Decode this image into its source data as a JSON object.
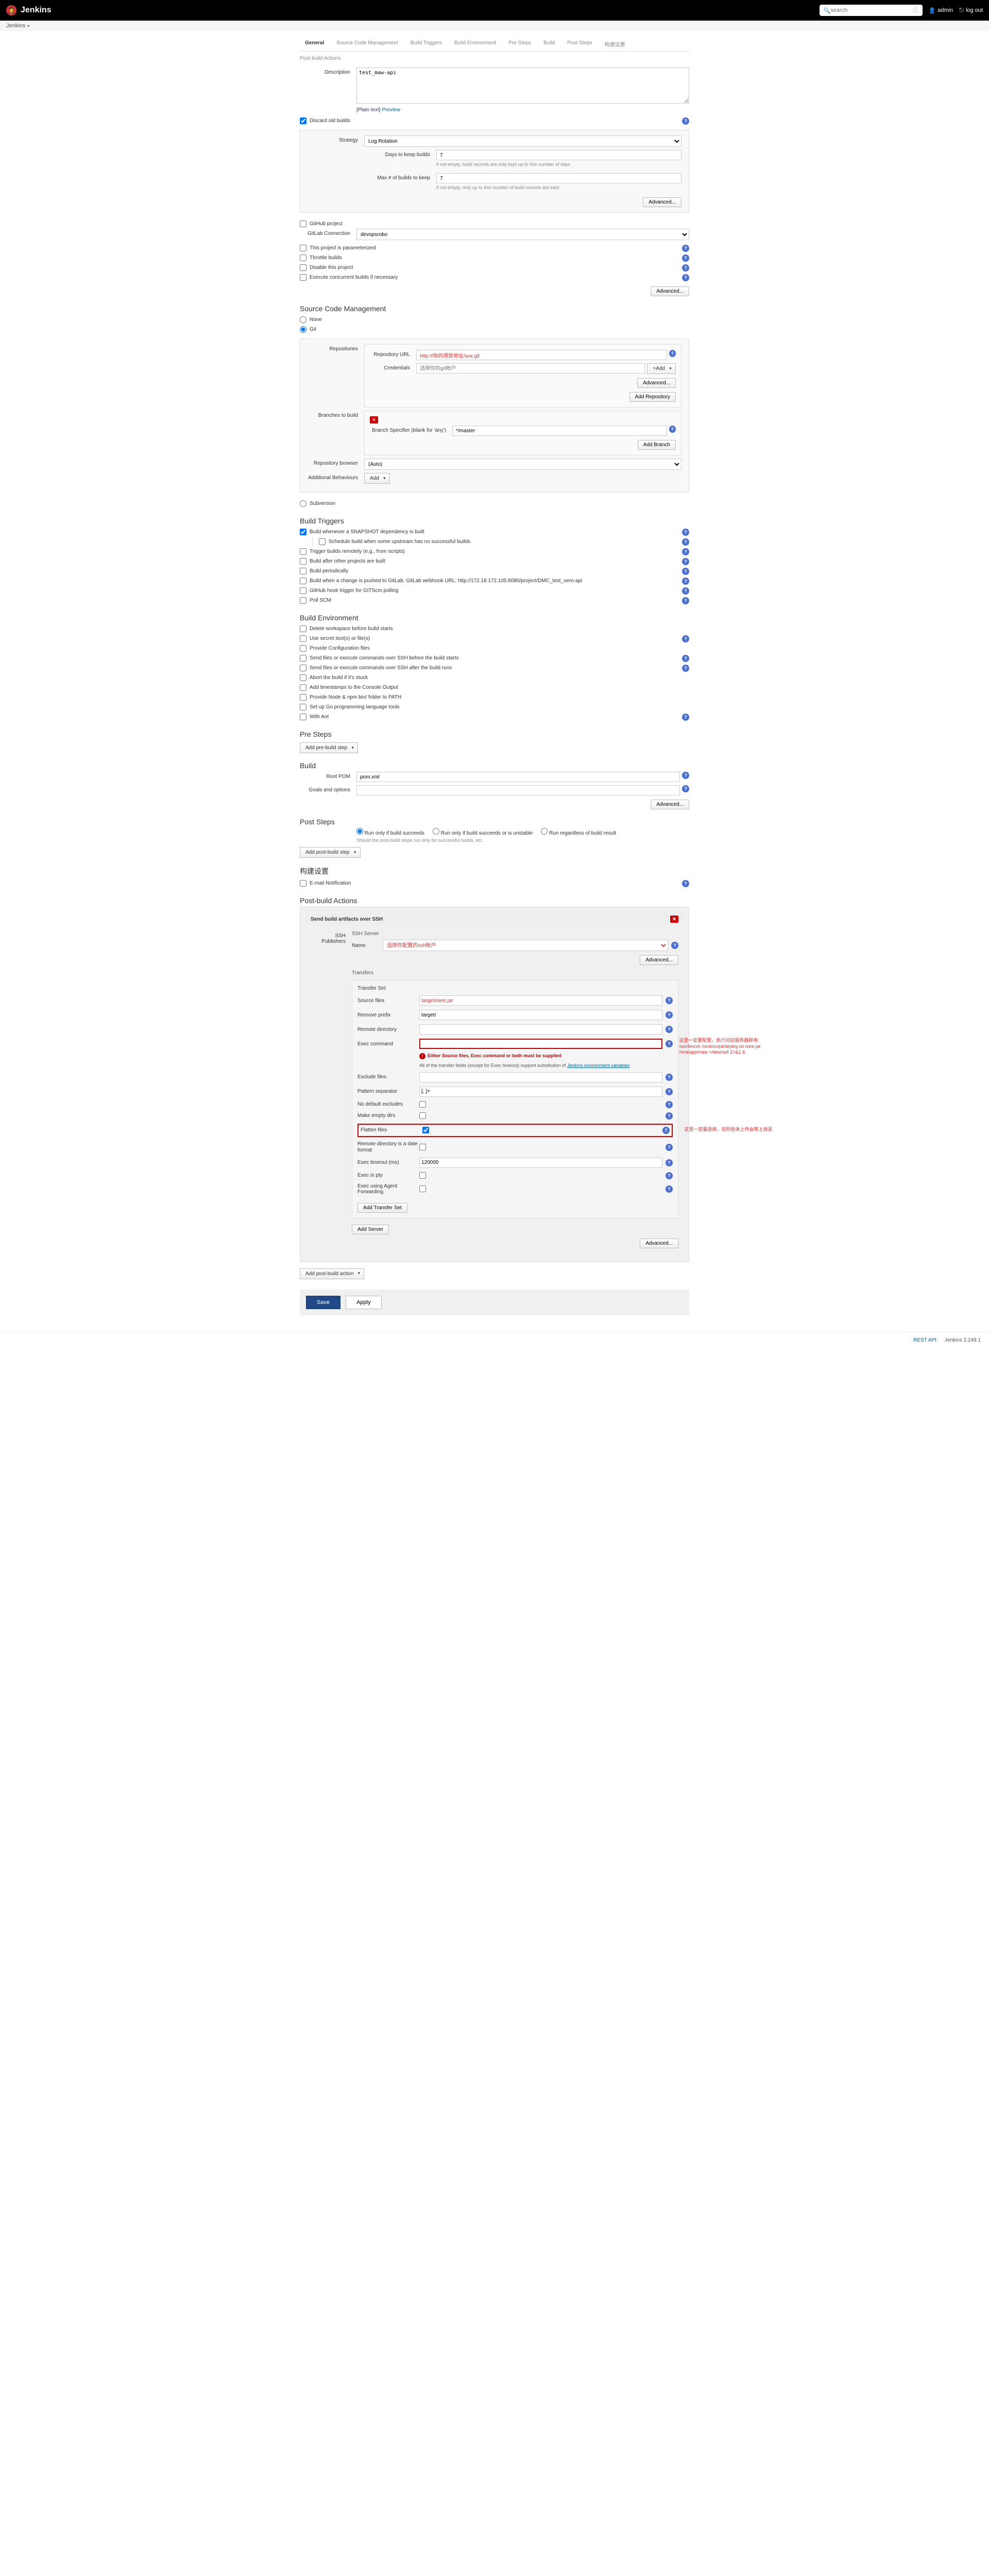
{
  "header": {
    "logo": "Jenkins",
    "search_placeholder": "search",
    "user": "admin",
    "logout": "log out"
  },
  "breadcrumb": {
    "item": "Jenkins"
  },
  "tabs": {
    "general": "General",
    "scm": "Source Code Management",
    "triggers": "Build Triggers",
    "env": "Build Environment",
    "presteps": "Pre Steps",
    "build": "Build",
    "poststeps": "Post Steps",
    "construct": "构建设置",
    "postbuild": "Post-build Actions"
  },
  "general": {
    "description_label": "Description",
    "description_value": "test_maw-api",
    "plain_text": "[Plain text]",
    "preview": "Preview",
    "discard_label": "Discard old builds",
    "strategy_label": "Strategy",
    "strategy_value": "Log Rotation",
    "days_keep_label": "Days to keep builds",
    "days_keep_value": "7",
    "days_hint": "if not empty, build records are only kept up to this number of days",
    "max_builds_label": "Max # of builds to keep",
    "max_builds_value": "7",
    "max_hint": "if not empty, only up to this number of build records are kept",
    "advanced": "Advanced...",
    "github_project": "GitHub project",
    "gitlab_conn_label": "GitLab Connection",
    "gitlab_conn_value": "devopsrobo",
    "param_label": "This project is parameterized",
    "throttle_label": "Throttle builds",
    "disable_label": "Disable this project",
    "concurrent_label": "Execute concurrent builds if necessary"
  },
  "scm": {
    "title": "Source Code Management",
    "none": "None",
    "git": "Git",
    "repositories_label": "Repositories",
    "repo_url_label": "Repository URL",
    "repo_url_value": "http://你的项目地址/xxx.git",
    "credentials_label": "Credentials",
    "credentials_placeholder": "选择你的git帐户",
    "add_btn": "+Add",
    "advanced": "Advanced...",
    "add_repo": "Add Repository",
    "branches_label": "Branches to build",
    "branch_spec_label": "Branch Specifier (blank for 'any')",
    "branch_spec_value": "*/master",
    "add_branch": "Add Branch",
    "repo_browser_label": "Repository browser",
    "repo_browser_value": "(Auto)",
    "addl_behaviours_label": "Additional Behaviours",
    "add": "Add",
    "subversion": "Subversion"
  },
  "triggers": {
    "title": "Build Triggers",
    "snapshot": "Build whenever a SNAPSHOT dependency is built",
    "schedule": "Schedule build when some upstream has no successful builds",
    "remote": "Trigger builds remotely (e.g., from scripts)",
    "after_other": "Build after other projects are built",
    "periodically": "Build periodically",
    "gitlab_push": "Build when a change is pushed to GitLab. GitLab webhook URL: http://172.18.172.105:8080/project/DMC_test_oem-api",
    "github_hook": "GitHub hook trigger for GITScm polling",
    "poll_scm": "Poll SCM"
  },
  "env": {
    "title": "Build Environment",
    "delete_ws": "Delete workspace before build starts",
    "secret": "Use secret text(s) or file(s)",
    "config_files": "Provide Configuration files",
    "ssh_before": "Send files or execute commands over SSH before the build starts",
    "ssh_after": "Send files or execute commands over SSH after the build runs",
    "abort_stuck": "Abort the build if it's stuck",
    "timestamps": "Add timestamps to the Console Output",
    "node_npm": "Provide Node & npm bin/ folder to PATH",
    "go_tools": "Set up Go programming language tools",
    "with_ant": "With Ant"
  },
  "presteps": {
    "title": "Pre Steps",
    "add_btn": "Add pre-build step"
  },
  "build": {
    "title": "Build",
    "root_pom_label": "Root POM",
    "root_pom_value": "pom.xml",
    "goals_label": "Goals and options",
    "goals_value": "",
    "advanced": "Advanced..."
  },
  "poststeps": {
    "title": "Post Steps",
    "radio1": "Run only if build succeeds",
    "radio2": "Run only if build succeeds or is unstable",
    "radio3": "Run regardless of build result",
    "desc": "Should the post-build steps run only for successful builds, etc.",
    "add_btn": "Add post-build step"
  },
  "construct": {
    "title": "构建设置",
    "email": "E-mail Notification"
  },
  "postbuild": {
    "title": "Post-build Actions",
    "ssh_title": "Send build artifacts over SSH",
    "ssh_publishers_label": "SSH Publishers",
    "ssh_server_label": "SSH Server",
    "name_label": "Name",
    "name_value": "选择你配置的ssh帐户",
    "advanced": "Advanced...",
    "transfers_label": "Transfers",
    "transfer_set": "Transfer Set",
    "source_files_label": "Source files",
    "source_files_value": "target/mee.jar",
    "remove_prefix_label": "Remove prefix",
    "remove_prefix_value": "target/",
    "remote_dir_label": "Remote directory",
    "exec_cmd_label": "Exec command",
    "error_msg": "Either Source files, Exec command or both must be supplied",
    "info1": "All of the transfer fields (except for Exec timeout) support substitution of",
    "info_link": "Jenkins environment variables",
    "exclude_label": "Exclude files",
    "pattern_label": "Pattern separator",
    "pattern_value": "[, ]+",
    "no_default_label": "No default excludes",
    "make_empty_label": "Make empty dirs",
    "flatten_label": "Flatten files",
    "remote_dir_date_label": "Remote directory is a date format",
    "exec_timeout_label": "Exec timeout (ms)",
    "exec_timeout_value": "120000",
    "exec_pty_label": "Exec in pty",
    "exec_agent_label": "Exec using Agent Forwarding",
    "add_transfer": "Add Transfer Set",
    "add_server": "Add Server",
    "add_action": "Add post-build action"
  },
  "annotations": {
    "exec_cmd": "这里一定要配置，执行对应服务器脚本:\n/usr/bin/sh /mnt/script/deploy.sh mee.jar /mnt/app/mee >/dev/null 2>&1 &",
    "flatten": "这里一定要选择，否则包体上传会带上目录"
  },
  "buttons": {
    "save": "Save",
    "apply": "Apply"
  },
  "footer": {
    "rest_api": "REST API",
    "version": "Jenkins 2.249.1"
  }
}
